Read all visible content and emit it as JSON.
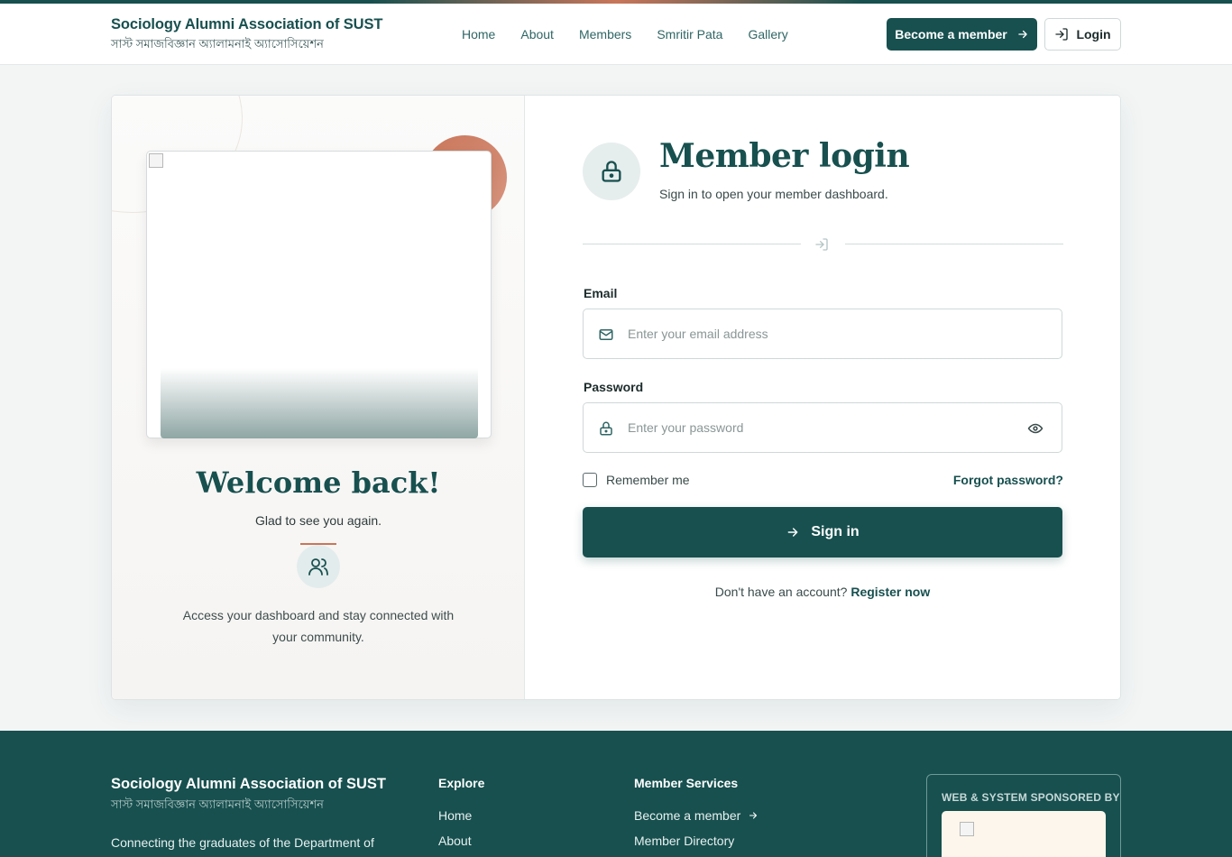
{
  "header": {
    "brand_en": "Sociology Alumni Association of SUST",
    "brand_bn": "সাস্ট সমাজবিজ্ঞান অ্যালামনাই অ্যাসোসিয়েশন",
    "nav": [
      "Home",
      "About",
      "Members",
      "Smritir Pata",
      "Gallery"
    ],
    "become_member": "Become a member",
    "login": "Login"
  },
  "welcome_panel": {
    "title": "Welcome back!",
    "subtitle": "Glad to see you again.",
    "description": "Access your dashboard and stay connected with your community."
  },
  "login_form": {
    "title": "Member login",
    "subtitle": "Sign in to open your member dashboard.",
    "email_label": "Email",
    "email_placeholder": "Enter your email address",
    "email_value": "",
    "password_label": "Password",
    "password_placeholder": "Enter your password",
    "password_value": "",
    "remember_me": "Remember me",
    "remember_checked": false,
    "forgot_password": "Forgot password?",
    "sign_in": "Sign in",
    "no_account": "Don't have an account?",
    "register": "Register now"
  },
  "footer": {
    "brand_en": "Sociology Alumni Association of SUST",
    "brand_bn": "সাস্ট সমাজবিজ্ঞান অ্যালামনাই অ্যাসোসিয়েশন",
    "description": "Connecting the graduates of the Department of",
    "explore_title": "Explore",
    "explore_links": [
      "Home",
      "About"
    ],
    "services_title": "Member Services",
    "services_links": [
      "Become a member",
      "Member Directory"
    ],
    "sponsor_title": "WEB & SYSTEM SPONSORED BY"
  },
  "colors": {
    "primary": "#17504f",
    "accent": "#c9765a",
    "background": "#f3f5f5"
  },
  "icons": [
    "arrow-right-icon",
    "login-icon",
    "lock-icon",
    "mail-icon",
    "eye-icon",
    "users-icon"
  ]
}
